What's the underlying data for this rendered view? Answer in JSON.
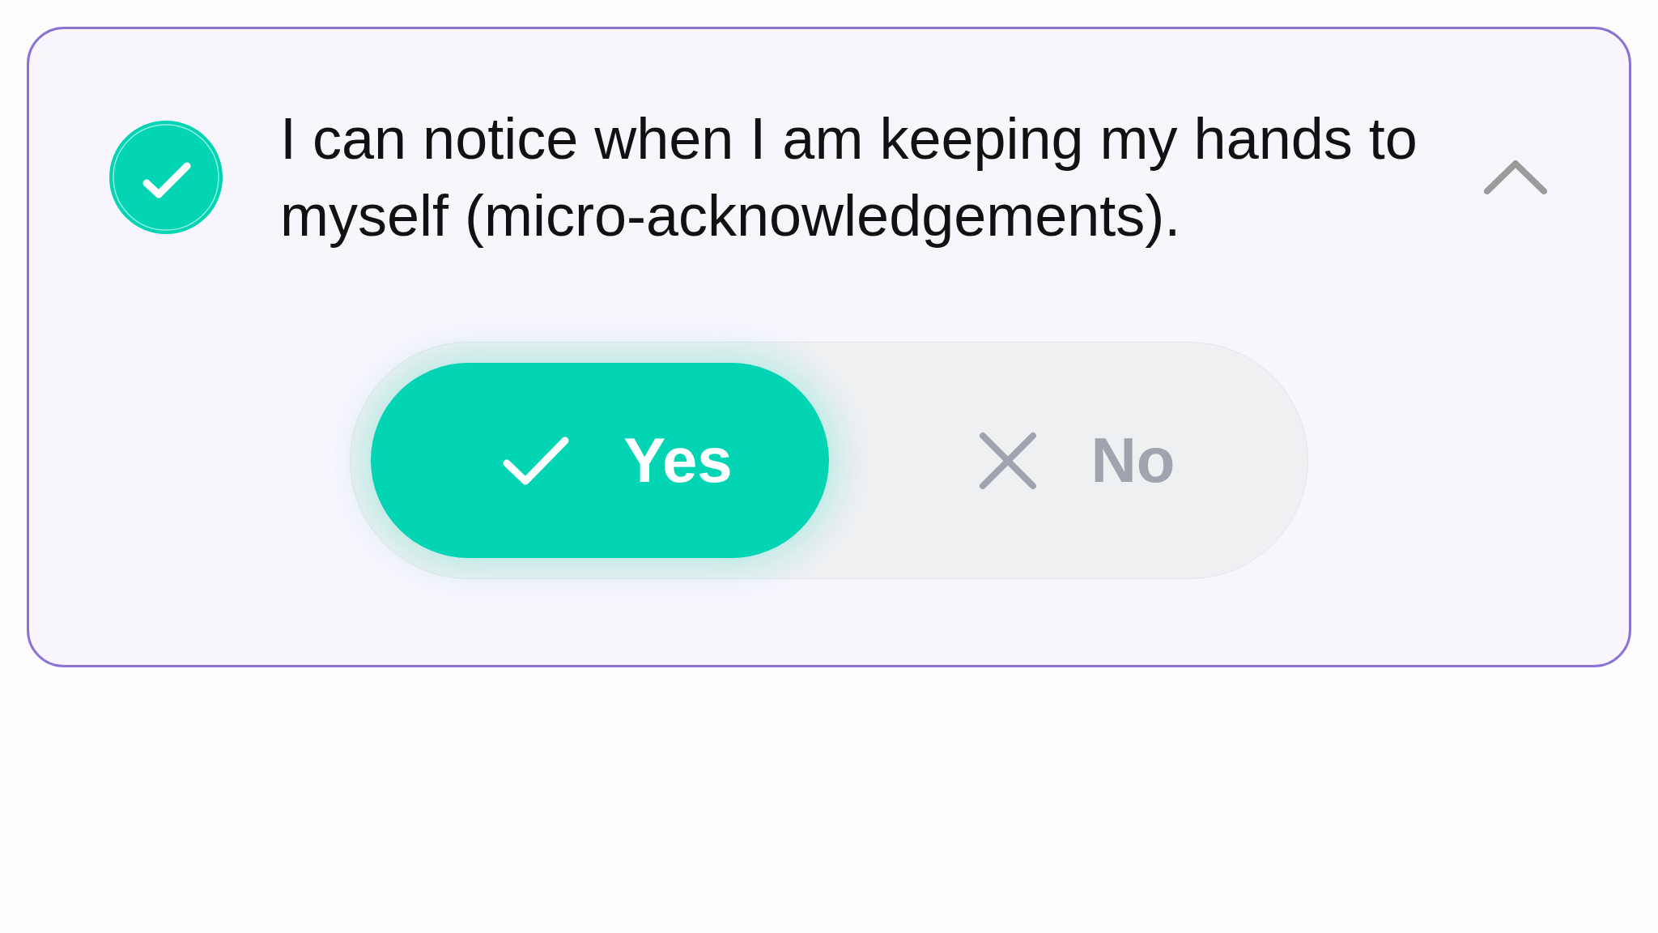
{
  "item": {
    "text": "I can notice when I am keeping my hands to myself (micro-acknowledgements).",
    "checked": true,
    "expanded": true
  },
  "answer": {
    "options": [
      {
        "kind": "yes",
        "label": "Yes",
        "selected": true
      },
      {
        "kind": "no",
        "label": "No",
        "selected": false
      }
    ]
  }
}
